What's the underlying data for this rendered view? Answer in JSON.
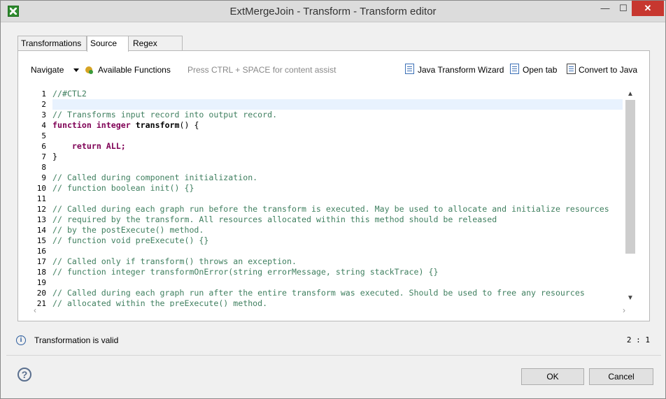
{
  "window": {
    "title": "ExtMergeJoin - Transform - Transform editor",
    "minimize_glyph": "—",
    "maximize_glyph": "☐",
    "close_glyph": "✕"
  },
  "tabs": [
    {
      "label": "Transformations",
      "active": false
    },
    {
      "label": "Source",
      "active": true
    },
    {
      "label": "Regex tester",
      "active": false
    }
  ],
  "toolbar": {
    "navigate": "Navigate",
    "available_functions": "Available Functions",
    "hint": "Press CTRL + SPACE for content assist",
    "java_wizard": "Java Transform Wizard",
    "open_tab": "Open tab",
    "convert_to_java": "Convert to Java"
  },
  "editor": {
    "line_numbers": [
      "1",
      "2",
      "3",
      "4",
      "5",
      "6",
      "7",
      "8",
      "9",
      "10",
      "11",
      "12",
      "13",
      "14",
      "15",
      "16",
      "17",
      "18",
      "19",
      "20",
      "21"
    ],
    "lines": [
      "//#CTL2",
      "",
      "// Transforms input record into output record.",
      "function integer transform() {",
      "",
      "    return ALL;",
      "}",
      "",
      "// Called during component initialization.",
      "// function boolean init() {}",
      "",
      "// Called during each graph run before the transform is executed. May be used to allocate and initialize resources",
      "// required by the transform. All resources allocated within this method should be released",
      "// by the postExecute() method.",
      "// function void preExecute() {}",
      "",
      "// Called only if transform() throws an exception.",
      "// function integer transformOnError(string errorMessage, string stackTrace) {}",
      "",
      "// Called during each graph run after the entire transform was executed. Should be used to free any resources",
      "// allocated within the preExecute() method."
    ],
    "tokens": {
      "function_kw": "function",
      "integer_kw": "integer",
      "fn_name": "transform",
      "fn_tail": "() {",
      "return_kw": "return",
      "return_value": "ALL;",
      "close_brace": "}",
      "indent": "    "
    }
  },
  "status": {
    "message": "Transformation is valid",
    "cursor": "2 : 1"
  },
  "buttons": {
    "ok": "OK",
    "cancel": "Cancel",
    "help": "?"
  },
  "colors": {
    "comment": "#3f7f5f",
    "keyword": "#7f0055",
    "current_line": "#e8f2fe",
    "close_button": "#c7372f"
  }
}
